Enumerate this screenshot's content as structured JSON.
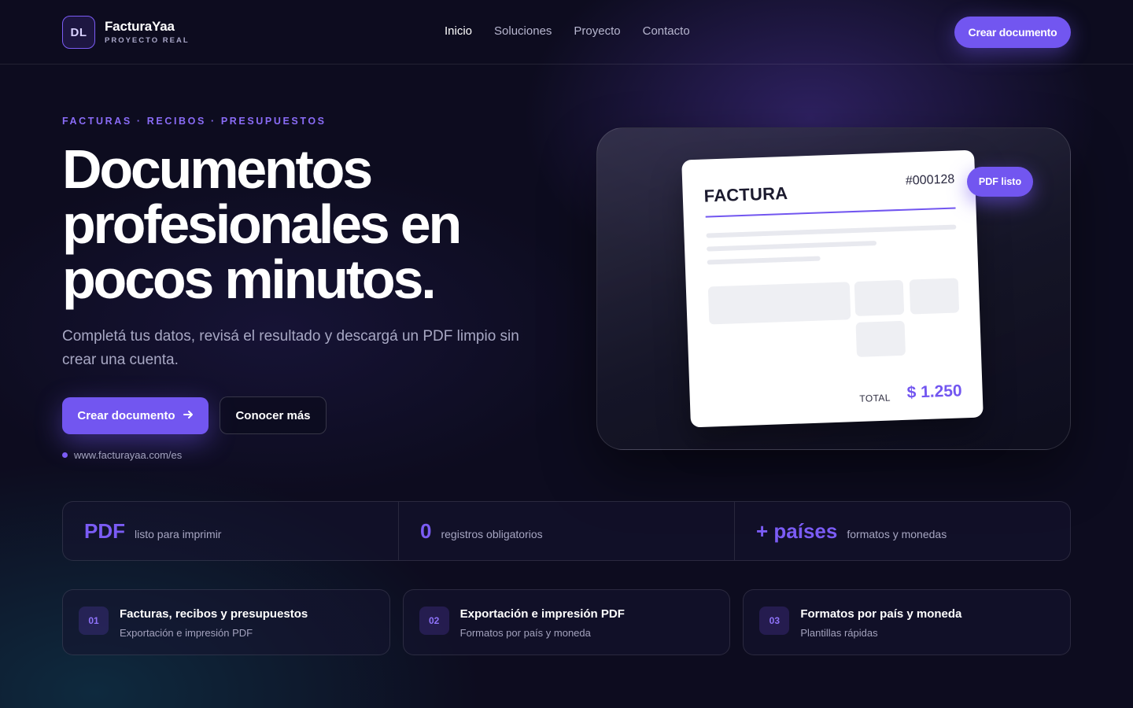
{
  "header": {
    "logo_initials": "DL",
    "brand_name": "FacturaYaa",
    "brand_sub": "PROYECTO REAL",
    "nav": [
      {
        "label": "Inicio",
        "active": true
      },
      {
        "label": "Soluciones",
        "active": false
      },
      {
        "label": "Proyecto",
        "active": false
      },
      {
        "label": "Contacto",
        "active": false
      }
    ],
    "cta_label": "Crear documento"
  },
  "hero": {
    "eyebrow": "FACTURAS · RECIBOS · PRESUPUESTOS",
    "title": "Documentos profesionales en pocos minutos.",
    "subtitle": "Completá tus datos, revisá el resultado y descargá un PDF limpio sin crear una cuenta.",
    "primary_button": "Crear documento",
    "primary_button_icon": "arrow-right-icon",
    "secondary_button": "Conocer más",
    "url": "www.facturayaa.com/es"
  },
  "preview": {
    "doc_title": "FACTURA",
    "doc_number": "#000128",
    "total_label": "TOTAL",
    "total_value": "$ 1.250",
    "badge": "PDF listo"
  },
  "stats": [
    {
      "value": "PDF",
      "label": "listo para imprimir"
    },
    {
      "value": "0",
      "label": "registros obligatorios"
    },
    {
      "value": "+ países",
      "label": "formatos y monedas"
    }
  ],
  "features": [
    {
      "num": "01",
      "title": "Facturas, recibos y presupuestos",
      "desc": "Exportación e impresión PDF"
    },
    {
      "num": "02",
      "title": "Exportación e impresión PDF",
      "desc": "Formatos por país y moneda"
    },
    {
      "num": "03",
      "title": "Formatos por país y moneda",
      "desc": "Plantillas rápidas"
    }
  ],
  "colors": {
    "accent": "#7256f0",
    "background": "#0d0c1f"
  }
}
